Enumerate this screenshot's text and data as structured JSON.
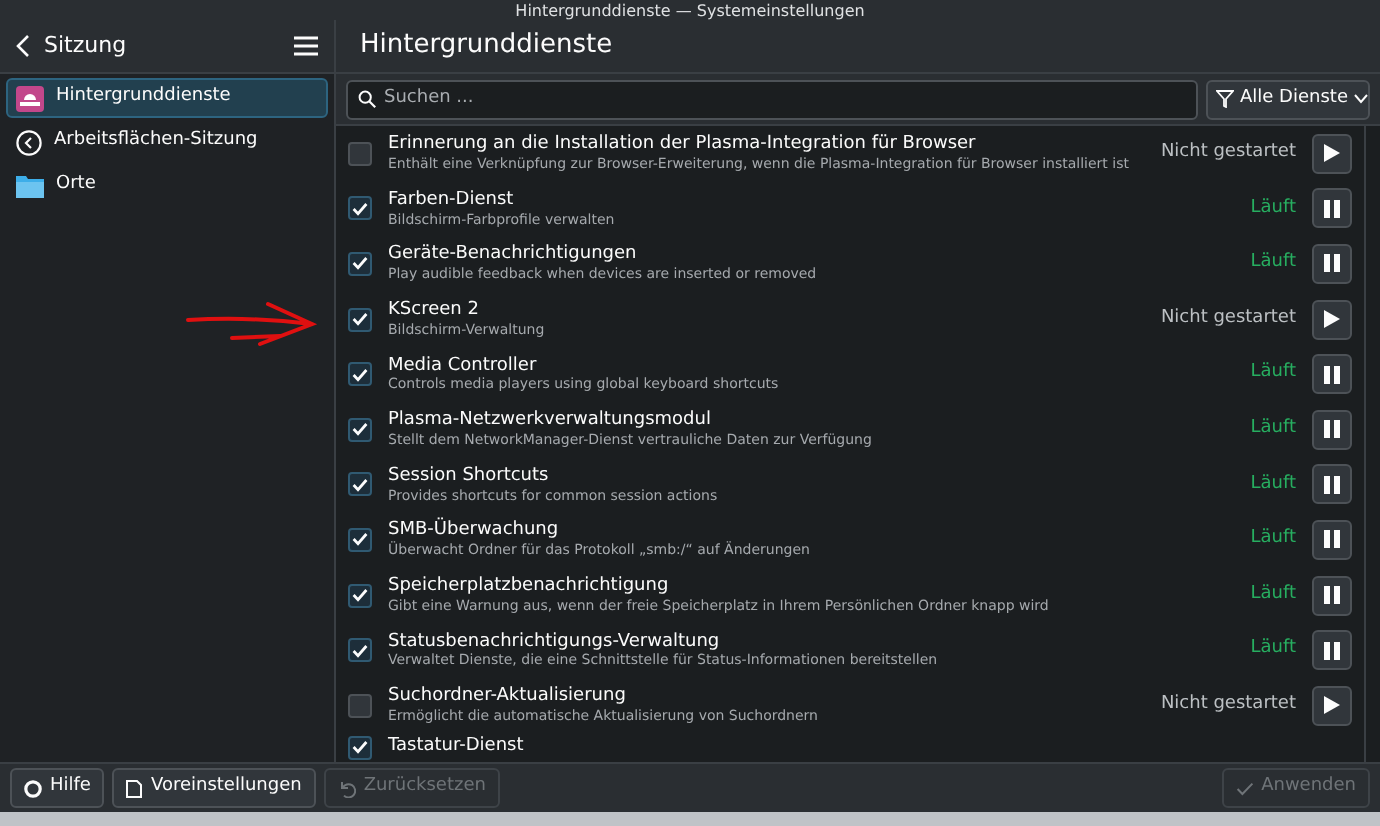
{
  "window": {
    "title": "Hintergrunddienste — Systemeinstellungen"
  },
  "sidebar": {
    "title": "Sitzung",
    "items": [
      {
        "label": "Hintergrunddienste",
        "selected": true
      },
      {
        "label": "Arbeitsflächen-Sitzung",
        "selected": false
      },
      {
        "label": "Orte",
        "selected": false
      }
    ]
  },
  "page": {
    "title": "Hintergrunddienste"
  },
  "search": {
    "placeholder": "Suchen ..."
  },
  "filter": {
    "value": "Alle Dienste"
  },
  "services": [
    {
      "title": "Erinnerung an die Installation der Plasma-Integration für Browser",
      "description": "Enthält eine Verknüpfung zur Browser-Erweiterung, wenn die Plasma-Integration für Browser installiert ist",
      "checked": false,
      "running": false,
      "status": "Nicht gestartet"
    },
    {
      "title": "Farben-Dienst",
      "description": "Bildschirm-Farbprofile verwalten",
      "checked": true,
      "running": true,
      "status": "Läuft"
    },
    {
      "title": "Geräte-Benachrichtigungen",
      "description": "Play audible feedback when devices are inserted or removed",
      "checked": true,
      "running": true,
      "status": "Läuft"
    },
    {
      "title": "KScreen 2",
      "description": "Bildschirm-Verwaltung",
      "checked": true,
      "running": false,
      "status": "Nicht gestartet"
    },
    {
      "title": "Media Controller",
      "description": "Controls media players using global keyboard shortcuts",
      "checked": true,
      "running": true,
      "status": "Läuft"
    },
    {
      "title": "Plasma-Netzwerkverwaltungsmodul",
      "description": "Stellt dem NetworkManager-Dienst vertrauliche Daten zur Verfügung",
      "checked": true,
      "running": true,
      "status": "Läuft"
    },
    {
      "title": "Session Shortcuts",
      "description": "Provides shortcuts for common session actions",
      "checked": true,
      "running": true,
      "status": "Läuft"
    },
    {
      "title": "SMB-Überwachung",
      "description": "Überwacht Ordner für das Protokoll „smb:/“ auf Änderungen",
      "checked": true,
      "running": true,
      "status": "Läuft"
    },
    {
      "title": "Speicherplatzbenachrichtigung",
      "description": "Gibt eine Warnung aus, wenn der freie Speicherplatz in Ihrem Persönlichen Ordner knapp wird",
      "checked": true,
      "running": true,
      "status": "Läuft"
    },
    {
      "title": "Statusbenachrichtigungs-Verwaltung",
      "description": "Verwaltet Dienste, die eine Schnittstelle für Status-Informationen bereitstellen",
      "checked": true,
      "running": true,
      "status": "Läuft"
    },
    {
      "title": "Suchordner-Aktualisierung",
      "description": "Ermöglicht die automatische Aktualisierung von Suchordnern",
      "checked": false,
      "running": false,
      "status": "Nicht gestartet"
    },
    {
      "title": "Tastatur-Dienst",
      "checked": true
    }
  ],
  "footer": {
    "buttons": [
      {
        "label": "Hilfe",
        "disabled": false
      },
      {
        "label": "Voreinstellungen",
        "disabled": false
      },
      {
        "label": "Zurücksetzen",
        "disabled": true
      }
    ],
    "apply": {
      "label": "Anwenden",
      "disabled": true
    }
  }
}
